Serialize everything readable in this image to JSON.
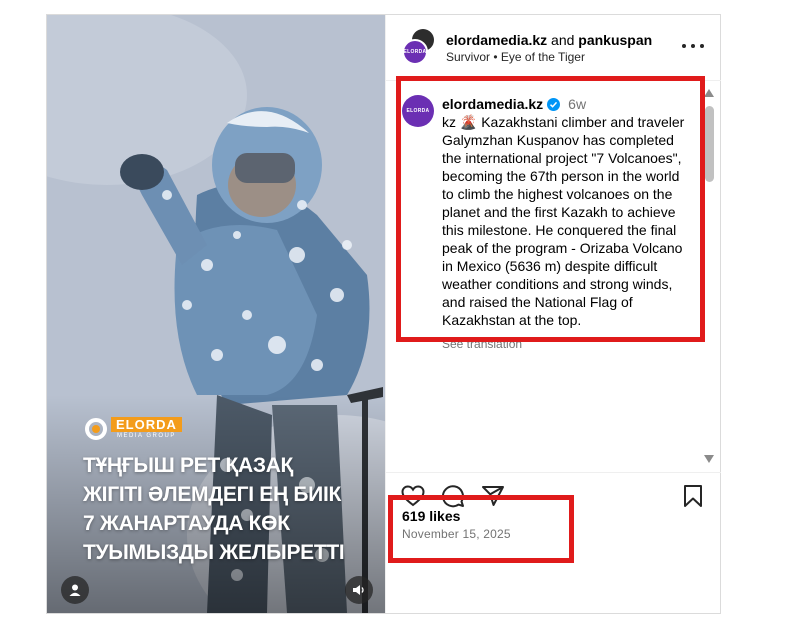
{
  "header": {
    "account_primary": "elordamedia.kz",
    "joiner": "and",
    "account_secondary": "pankuspan",
    "audio_artist": "Survivor",
    "separator": "•",
    "audio_track": "Eye of the Tiger",
    "primary_avatar_text": "ELORDA"
  },
  "media": {
    "brand_name": "ELORDA",
    "brand_sub": "MEDIA GROUP",
    "headline_lines": [
      "ТҰҢҒЫШ РЕТ ҚАЗАҚ",
      "ЖІГІТІ ӘЛЕМДЕГІ ЕҢ БИІК",
      "7 ЖАНАРТАУДА КӨК",
      "ТУЫМЫЗДЫ ЖЕЛБІРЕТТІ"
    ]
  },
  "caption": {
    "username": "elordamedia.kz",
    "time_ago": "6w",
    "text": "kz 🌋 Kazakhstani climber and traveler Galymzhan Kuspanov has completed the international project \"7 Volcanoes\", becoming the 67th person in the world to climb the highest volcanoes on the planet and the first Kazakh to achieve this milestone. He conquered the final peak of the program - Orizaba Volcano in Mexico (5636 m) despite difficult weather conditions and strong winds, and raised the National Flag of Kazakhstan at the top.",
    "see_translation": "See translation"
  },
  "footer": {
    "likes": "619 likes",
    "date": "November 15, 2025"
  },
  "icons": {
    "like": "heart-icon",
    "comment": "comment-icon",
    "share": "send-icon",
    "save": "bookmark-icon",
    "more": "more-icon",
    "user_tag": "user-icon",
    "mute": "speaker-icon",
    "verified": "verified-badge-icon"
  },
  "colors": {
    "highlight": "#e01b1b",
    "brand_orange": "#f39c1b",
    "avatar_purple": "#6b2fb3",
    "verified_blue": "#0095f6"
  }
}
